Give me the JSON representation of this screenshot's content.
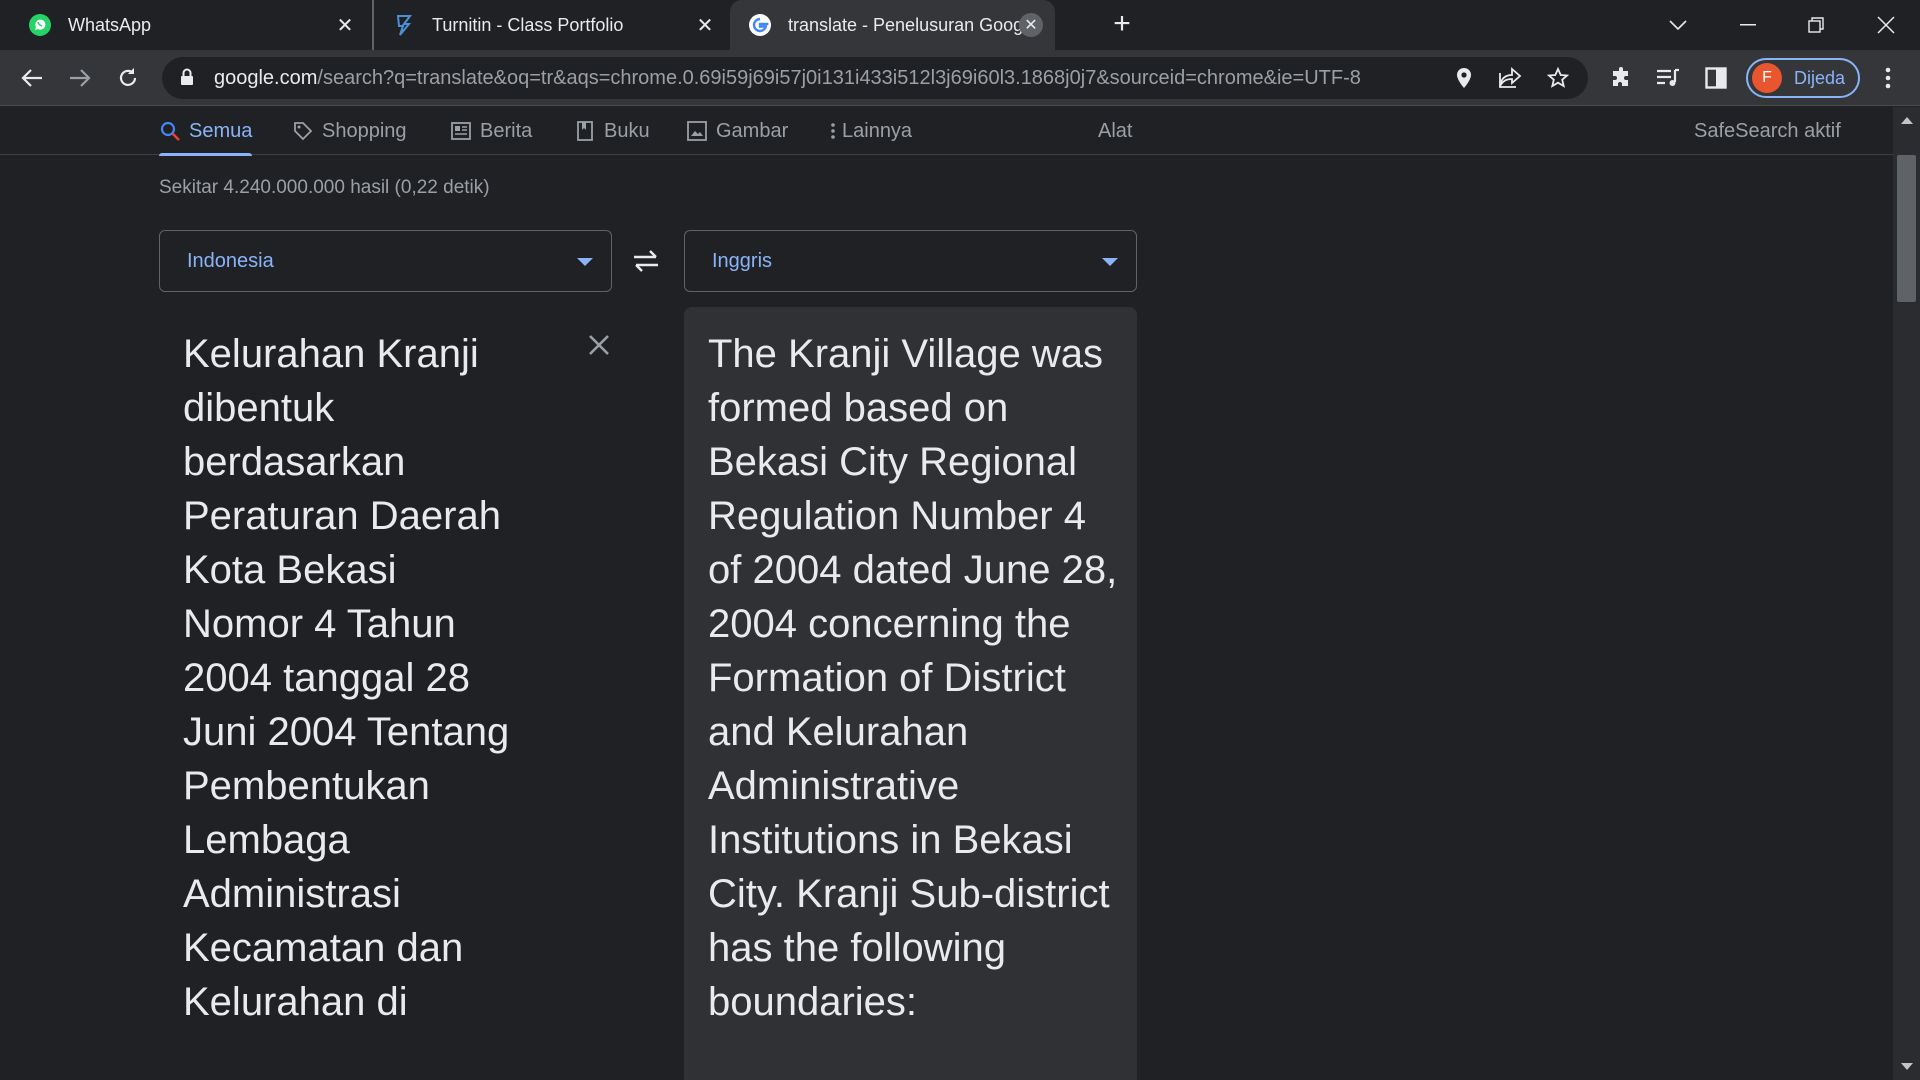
{
  "tabs": [
    {
      "title": "WhatsApp",
      "icon": "whatsapp-icon"
    },
    {
      "title": "Turnitin - Class Portfolio",
      "icon": "turnitin-icon"
    },
    {
      "title": "translate - Penelusuran Google",
      "icon": "google-icon",
      "active": true
    }
  ],
  "toolbar": {
    "url_host": "google.com",
    "url_path": "/search?q=translate&oq=tr&aqs=chrome.0.69i59j69i57j0i131i433i512l3j69i60l3.1868j0j7&sourceid=chrome&ie=UTF-8",
    "profile_initial": "F",
    "profile_label": "Dijeda",
    "profile_color": "#e8552e",
    "accent_color": "#8ab4f8"
  },
  "search_nav": {
    "items": [
      {
        "label": "Semua",
        "icon": "search-icon"
      },
      {
        "label": "Shopping",
        "icon": "tag-icon"
      },
      {
        "label": "Berita",
        "icon": "news-icon"
      },
      {
        "label": "Buku",
        "icon": "book-icon"
      },
      {
        "label": "Gambar",
        "icon": "image-icon"
      },
      {
        "label": "Lainnya",
        "icon": "more-vert-icon"
      }
    ],
    "tools_label": "Alat",
    "safesearch_label": "SafeSearch aktif"
  },
  "result_stats": "Sekitar 4.240.000.000 hasil (0,22 detik)",
  "translator": {
    "source_language": "Indonesia",
    "target_language": "Inggris",
    "source_text": "Kelurahan Kranji dibentuk berdasarkan Peraturan Daerah Kota Bekasi Nomor 4 Tahun 2004 tanggal 28 Juni 2004 Tentang Pembentukan Lembaga Administrasi Kecamatan dan Kelurahan di",
    "target_text": "The Kranji Village was formed based on Bekasi City Regional Regulation Number 4 of 2004 dated June 28, 2004 concerning the Formation of District and Kelurahan Administrative Institutions in Bekasi City. Kranji Sub-district has the following boundaries:"
  }
}
